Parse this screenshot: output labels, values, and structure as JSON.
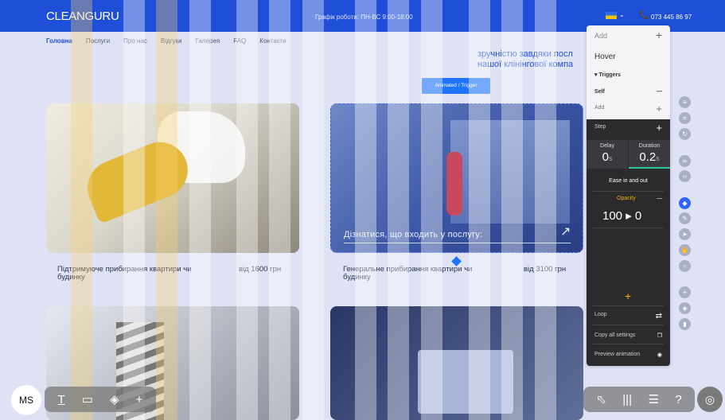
{
  "site": {
    "logo": "CLEANGURU",
    "hours": "Графік роботи: ПН-ВС 9:00-18:00",
    "phone": "073 445 86 97",
    "nav": [
      "Головна",
      "Послуги",
      "Про нас",
      "Відгуки",
      "Галерея",
      "FAQ",
      "Контакти"
    ],
    "heading_line1": "зручністю завдяки посл",
    "heading_line2": "нашої клінінгової компа",
    "trigger_badge": "Animated / Trigger",
    "cta_text": "Дізнатися, що входить у послугу:",
    "services": [
      {
        "title": "Підтримуюче прибирання квартири чи будинку",
        "price": "від 1600 грн"
      },
      {
        "title": "Генеральне прибирання квартири чи будинку",
        "price": "від 3100 грн"
      }
    ]
  },
  "panel": {
    "add_placeholder": "Add",
    "hover_label": "Hover",
    "triggers_label": "▾ Triggers",
    "self_label": "Self",
    "add_label": "Add",
    "step_label": "Step",
    "delay_label": "Delay",
    "delay_value": "0",
    "delay_unit": "s",
    "duration_label": "Duration",
    "duration_value": "0.2",
    "duration_unit": "s",
    "ease_label": "Ease in and out",
    "opacity_label": "Opacity",
    "opacity_value": "100 ▸ 0",
    "loop_label": "Loop",
    "copy_label": "Copy all settings",
    "preview_label": "Preview animation"
  },
  "toolbar": {
    "avatar": "MS"
  },
  "colors": {
    "brand": "#1f4ed8",
    "accent": "#1f74ff",
    "opacity_accent": "#f2b400",
    "duration_underline": "#2dc6a2"
  }
}
